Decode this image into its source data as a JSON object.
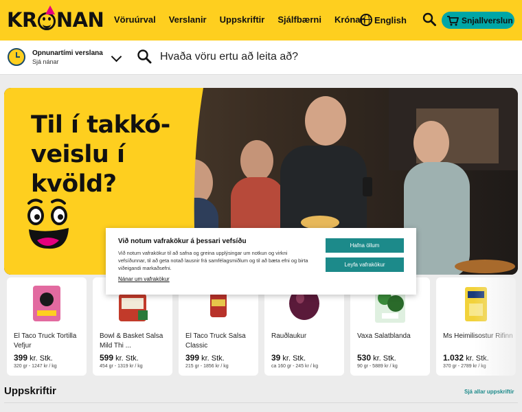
{
  "brand": {
    "logo_text": "KRONAN"
  },
  "nav": {
    "items": [
      "Vöruúrval",
      "Verslanir",
      "Uppskriftir",
      "Sjálfbærni",
      "Krónan"
    ],
    "language": "English",
    "cart_label": "Snjallverslun"
  },
  "subbar": {
    "hours_title": "Opnunartími verslana",
    "hours_link": "Sjá nánar",
    "search_placeholder": "Hvaða vöru ertu að leita að?"
  },
  "hero": {
    "title": "Til í takkó-veislu í kvöld?"
  },
  "cookie": {
    "title": "Við notum vafrakökur á þessari vefsíðu",
    "text": "Við notum vafrakökur til að safna og greina upplýsingar um notkun og virkni vefsíðunnar, til að geta notað lausnir frá samfélagsmiðlum og til að bæta efni og birta viðeigandi markaðsefni.",
    "link": "Nánar um vafrakökur",
    "reject_label": "Hafna öllum",
    "accept_label": "Leyfa vafrakökur"
  },
  "products": [
    {
      "name": "El Taco Truck Tortilla Vefjur",
      "price": "399",
      "unit_label": "kr. Stk.",
      "unit_price": "320 gr - 1247 kr / kg",
      "icon": "tortilla-pack"
    },
    {
      "name": "Bowl & Basket Salsa Mild Thi ...",
      "price": "599",
      "unit_label": "kr. Stk.",
      "unit_price": "454 gr - 1319 kr / kg",
      "icon": "salsa-jar"
    },
    {
      "name": "El Taco Truck Salsa Classic",
      "price": "399",
      "unit_label": "kr. Stk.",
      "unit_price": "215 gr - 1856 kr / kg",
      "icon": "salsa-bottle"
    },
    {
      "name": "Rauðlaukur",
      "price": "39",
      "unit_label": "kr. Stk.",
      "unit_price": "ca 160 gr - 245 kr / kg",
      "icon": "red-onion"
    },
    {
      "name": "Vaxa Salatblanda",
      "price": "530",
      "unit_label": "kr. Stk.",
      "unit_price": "90 gr - 5889 kr / kg",
      "icon": "salad-pack"
    },
    {
      "name": "Ms Heimilisostur Rifinn",
      "price": "1.032",
      "unit_label": "kr. Stk.",
      "unit_price": "370 gr - 2789 kr / kg",
      "icon": "cheese-bag"
    }
  ],
  "recipes": {
    "title": "Uppskriftir",
    "link": "Sjá allar uppskriftir"
  },
  "colors": {
    "brand_yellow": "#fecf1f",
    "accent_teal": "#00a6a6",
    "button_teal": "#1c8a8a"
  }
}
